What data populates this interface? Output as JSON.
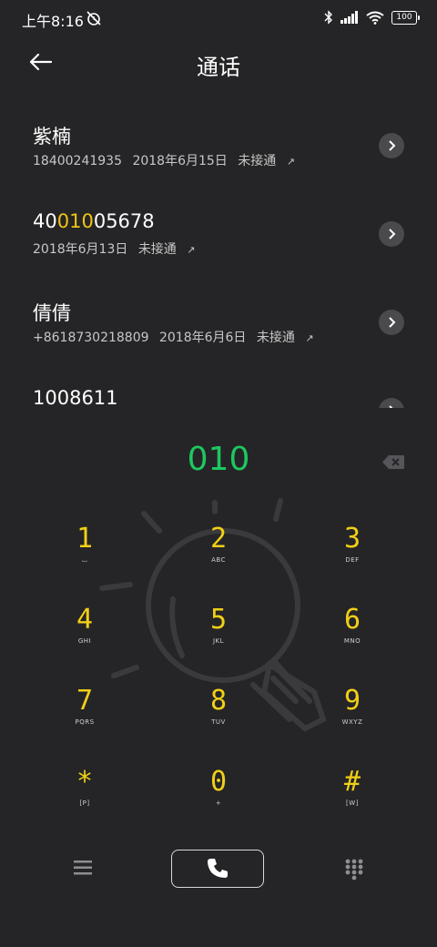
{
  "status_bar": {
    "time": "上午8:16",
    "battery": "100"
  },
  "header": {
    "title": "通话"
  },
  "calls": [
    {
      "name_parts": [
        "紫楠",
        "",
        ""
      ],
      "number": "18400241935",
      "date": "2018年6月15日",
      "status": "未接通"
    },
    {
      "name_parts": [
        "40",
        "010",
        "05678"
      ],
      "number": "",
      "date": "2018年6月13日",
      "status": "未接通"
    },
    {
      "name_parts": [
        "倩倩",
        "",
        ""
      ],
      "number": "+8618730218809",
      "date": "2018年6月6日",
      "status": "未接通"
    },
    {
      "name_parts": [
        "1008611",
        "",
        ""
      ],
      "number": "",
      "date": "",
      "status": ""
    }
  ],
  "dialer": {
    "input_value": "010"
  },
  "keypad": [
    {
      "digit": "1",
      "letters": "⌴"
    },
    {
      "digit": "2",
      "letters": "ABC"
    },
    {
      "digit": "3",
      "letters": "DEF"
    },
    {
      "digit": "4",
      "letters": "GHI"
    },
    {
      "digit": "5",
      "letters": "JKL"
    },
    {
      "digit": "6",
      "letters": "MNO"
    },
    {
      "digit": "7",
      "letters": "PQRS"
    },
    {
      "digit": "8",
      "letters": "TUV"
    },
    {
      "digit": "9",
      "letters": "WXYZ"
    },
    {
      "digit": "*",
      "letters": "[P]"
    },
    {
      "digit": "0",
      "letters": "+"
    },
    {
      "digit": "#",
      "letters": "[W]"
    }
  ],
  "colors": {
    "background": "#252527",
    "accent_yellow": "#f1cf17",
    "dial_green": "#1ec760"
  },
  "icons": {
    "back": "arrow-left-icon",
    "detail": "chevron-right-icon",
    "backspace": "backspace-icon",
    "menu": "menu-icon",
    "call": "phone-icon",
    "dialpad": "dialpad-icon"
  }
}
